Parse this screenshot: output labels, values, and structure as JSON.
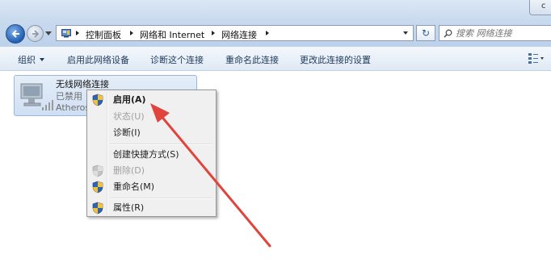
{
  "address": {
    "crumbs": [
      "控制面板",
      "网络和 Internet",
      "网络连接"
    ],
    "search_placeholder": "搜索 网络连接",
    "refresh_glyph": "↻"
  },
  "window": {
    "close_glyph": "c"
  },
  "toolbar": {
    "organize": "组织",
    "buttons": [
      "启用此网络设备",
      "诊断这个连接",
      "重命名此连接",
      "更改此连接的设置"
    ]
  },
  "connection": {
    "name": "无线网络连接",
    "status": "已禁用",
    "device": "Atheros"
  },
  "context_menu": {
    "items": [
      {
        "label": "启用(A)",
        "bold": true,
        "disabled": false,
        "shield": true
      },
      {
        "label": "状态(U)",
        "bold": false,
        "disabled": true,
        "shield": false
      },
      {
        "label": "诊断(I)",
        "bold": false,
        "disabled": false,
        "shield": false
      },
      {
        "label": "创建快捷方式(S)",
        "bold": false,
        "disabled": false,
        "shield": false
      },
      {
        "label": "删除(D)",
        "bold": false,
        "disabled": true,
        "shield": true
      },
      {
        "label": "重命名(M)",
        "bold": false,
        "disabled": false,
        "shield": true
      },
      {
        "label": "属性(R)",
        "bold": false,
        "disabled": false,
        "shield": true
      }
    ]
  },
  "colors": {
    "annotation_arrow": "#e0443c",
    "accent": "#1e395b"
  }
}
